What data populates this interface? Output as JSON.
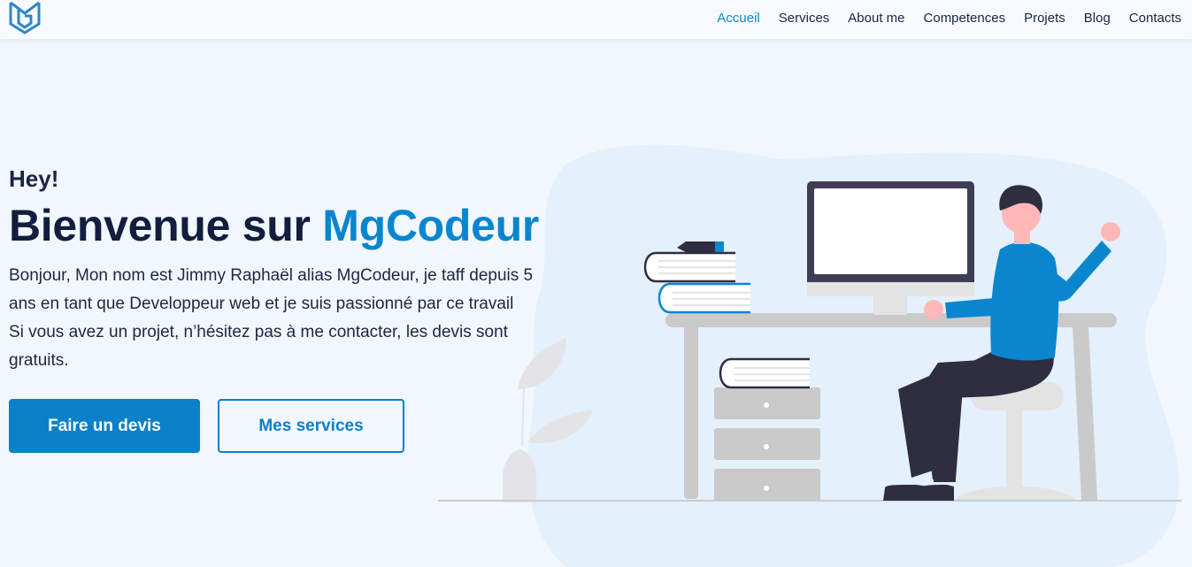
{
  "nav": {
    "items": [
      {
        "label": "Accueil",
        "active": true
      },
      {
        "label": "Services",
        "active": false
      },
      {
        "label": "About me",
        "active": false
      },
      {
        "label": "Competences",
        "active": false
      },
      {
        "label": "Projets",
        "active": false
      },
      {
        "label": "Blog",
        "active": false
      },
      {
        "label": "Contacts",
        "active": false
      }
    ]
  },
  "hero": {
    "greeting": "Hey!",
    "title_prefix": "Bienvenue sur ",
    "title_brand": "MgCodeur",
    "description_line1": "Bonjour, Mon nom est Jimmy Raphaël alias MgCodeur, je taff depuis 5 ans en tant que Developpeur web et je suis passionné par ce travail",
    "description_line2": "Si vous avez un projet, n’hésitez pas à me contacter, les devis sont gratuits.",
    "primary_button": "Faire un devis",
    "secondary_button": "Mes services"
  },
  "colors": {
    "accent": "#0a86cf",
    "button": "#0a80c9",
    "text_dark": "#131d3d",
    "background": "#f1f7fd"
  },
  "icons": {
    "logo": "mg-logo-icon"
  }
}
